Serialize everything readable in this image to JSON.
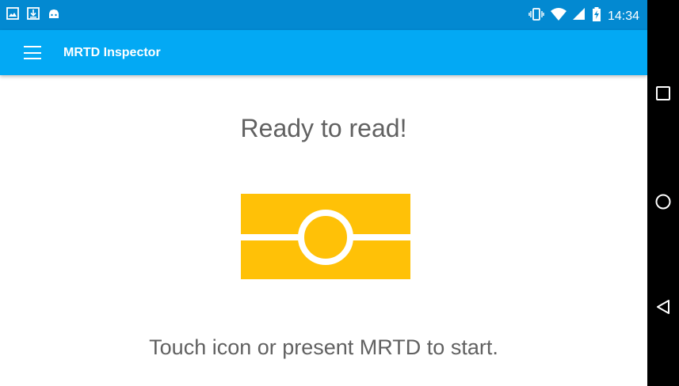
{
  "status_bar": {
    "time": "14:34",
    "left_icons": [
      "image-icon",
      "download-icon",
      "android-icon"
    ],
    "right_icons": [
      "vibrate-icon",
      "wifi-icon",
      "signal-icon",
      "battery-charging-icon"
    ]
  },
  "app_bar": {
    "title": "MRTD Inspector",
    "menu_icon": "hamburger-menu-icon"
  },
  "main": {
    "heading": "Ready to read!",
    "icon": "nfc-card-icon",
    "instruction": "Touch icon or present MRTD to start."
  },
  "nav_bar": {
    "buttons": [
      "recents-button",
      "home-button",
      "back-button"
    ]
  },
  "colors": {
    "status_bar": "#0389d1",
    "app_bar": "#03a9f4",
    "card_icon": "#ffc107",
    "text_gray": "#616161",
    "nav_bar": "#000000"
  }
}
